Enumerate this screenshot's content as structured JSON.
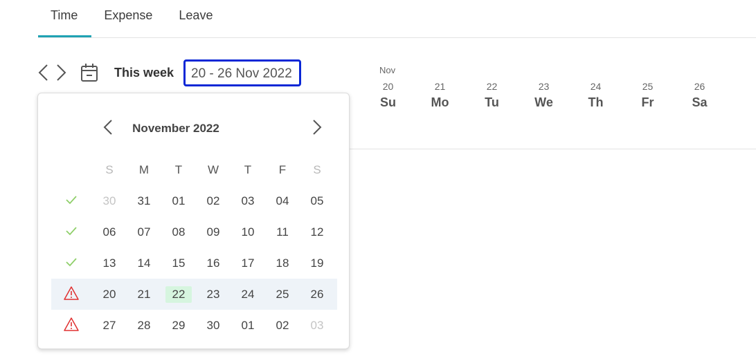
{
  "tabs": [
    {
      "label": "Time",
      "active": true
    },
    {
      "label": "Expense",
      "active": false
    },
    {
      "label": "Leave",
      "active": false
    }
  ],
  "toolbar": {
    "this_week_label": "This week",
    "date_range": "20 - 26 Nov 2022",
    "icons": [
      "chevron-left-icon",
      "chevron-right-icon",
      "calendar-icon"
    ]
  },
  "week": {
    "month": "Nov",
    "days": [
      {
        "num": "20",
        "name": "Su"
      },
      {
        "num": "21",
        "name": "Mo"
      },
      {
        "num": "22",
        "name": "Tu"
      },
      {
        "num": "23",
        "name": "We"
      },
      {
        "num": "24",
        "name": "Th"
      },
      {
        "num": "25",
        "name": "Fr"
      },
      {
        "num": "26",
        "name": "Sa"
      }
    ]
  },
  "calendar": {
    "title": "November 2022",
    "weekdays": [
      "S",
      "M",
      "T",
      "W",
      "T",
      "F",
      "S"
    ],
    "weeks": [
      {
        "status": "check",
        "days": [
          "30",
          "31",
          "01",
          "02",
          "03",
          "04",
          "05"
        ]
      },
      {
        "status": "check",
        "days": [
          "06",
          "07",
          "08",
          "09",
          "10",
          "11",
          "12"
        ]
      },
      {
        "status": "check",
        "days": [
          "13",
          "14",
          "15",
          "16",
          "17",
          "18",
          "19"
        ]
      },
      {
        "status": "warning",
        "days": [
          "20",
          "21",
          "22",
          "23",
          "24",
          "25",
          "26"
        ]
      },
      {
        "status": "warning",
        "days": [
          "27",
          "28",
          "29",
          "30",
          "01",
          "02",
          "03"
        ]
      }
    ],
    "selected_week": 3,
    "today": "22",
    "colors": {
      "accent": "#1fa2b3",
      "check": "#8fcf6a",
      "warning": "#e03030",
      "today_bg": "#d6f5df",
      "selected_row": "#eef3f8",
      "focus_border": "#0a27d6"
    }
  }
}
